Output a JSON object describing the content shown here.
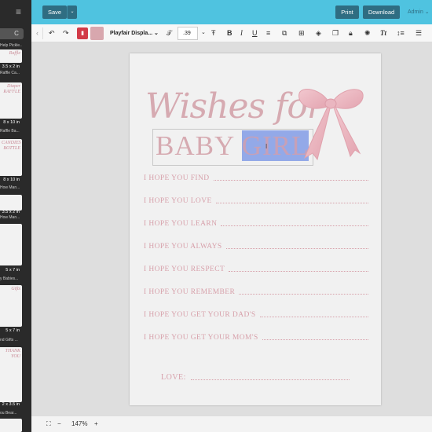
{
  "left_panel": {
    "menu_icon": "hamburger-icon",
    "search_icon": "refresh-icon",
    "thumbnails": [
      {
        "title": "Help Pickle...",
        "size": "",
        "deco": ""
      },
      {
        "title": "Raffle Ca...",
        "size": "3.5 x 2 in",
        "deco": "Raffle"
      },
      {
        "title": "Raffle Ba...",
        "size": "8 x 10 in",
        "deco": "Diaper RAFFLE"
      },
      {
        "title": "How Man...",
        "size": "8 x 10 in",
        "deco": "CANDIES BOTTLE"
      },
      {
        "title": "How Man...",
        "size": "3.5 x 2 in",
        "deco": ""
      },
      {
        "title": "y Babies...",
        "size": "5 x 7 in",
        "deco": ""
      },
      {
        "title": "nd Gifts ...",
        "size": "5 x 7 in",
        "deco": "Gifts"
      },
      {
        "title": "ou Bear...",
        "size": "2 x 3.5 in",
        "deco": "THANK YOU"
      }
    ]
  },
  "toolbar": {
    "save_label": "Save",
    "print_label": "Print",
    "download_label": "Download",
    "admin_label": "Admin"
  },
  "format_bar": {
    "font_name": "Playfair Displa...",
    "font_size": ".39",
    "text_color": "#d8a7ae"
  },
  "document": {
    "title_script": "Wishes for",
    "title_plain": "BABY",
    "title_selected": "GIRL",
    "lines": [
      "I HOPE YOU FIND",
      "I HOPE YOU LOVE",
      "I HOPE YOU LEARN",
      "I HOPE YOU ALWAYS",
      "I HOPE YOU RESPECT",
      "I HOPE YOU REMEMBER",
      "I HOPE YOU GET YOUR DAD'S",
      "I HOPE YOU GET YOUR MOM'S"
    ],
    "signoff": "LOVE:"
  },
  "status_bar": {
    "zoom": "147%"
  },
  "colors": {
    "topbar": "#4fc3e0",
    "accent_button": "#2f6d82",
    "pink_text": "#d6aab1",
    "selection": "#93a9e8"
  }
}
